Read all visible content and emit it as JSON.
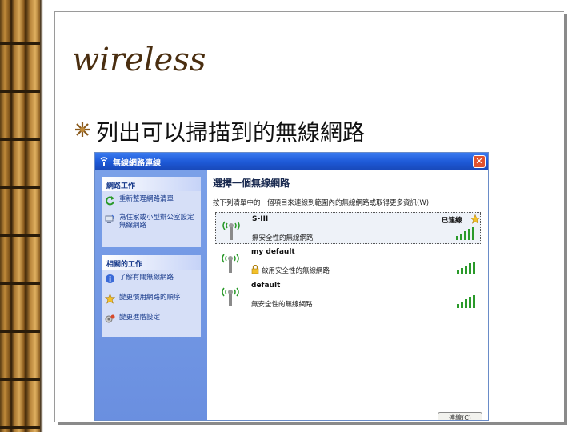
{
  "slide": {
    "title": "wireless",
    "bullet": "列出可以掃描到的無線網路"
  },
  "window": {
    "title": "無線網路連線",
    "close_label": "✕"
  },
  "sidebar": {
    "network_tasks": {
      "header": "網路工作",
      "items": [
        {
          "icon": "refresh-icon",
          "label": "重新整理網路清單"
        },
        {
          "icon": "home-network-icon",
          "label": "為住家或小型辦公室設定無線網路"
        }
      ]
    },
    "related_tasks": {
      "header": "相關的工作",
      "items": [
        {
          "icon": "info-icon",
          "label": "了解有關無線網路"
        },
        {
          "icon": "star-icon",
          "label": "變更慣用網路的順序"
        },
        {
          "icon": "settings-icon",
          "label": "變更進階設定"
        }
      ]
    }
  },
  "main": {
    "title": "選擇一個無線網路",
    "description": "按下列清單中的一個項目來連線到範圍內的無線網路或取得更多資訊(W)",
    "networks": [
      {
        "name": "S-III",
        "status": "無安全性的無線網路",
        "connection": "已連線",
        "signal": 5,
        "selected": true
      },
      {
        "name": "my default",
        "status": "啟用安全性的無線網路",
        "connection": "",
        "signal": 5,
        "selected": false
      },
      {
        "name": "default",
        "status": "無安全性的無線網路",
        "connection": "",
        "signal": 5,
        "selected": false
      }
    ],
    "button_label": "連線(C)"
  },
  "colors": {
    "titlebar": "#1e5ad8",
    "sidebar": "#6a8fe0",
    "signal": "#2a9a2a",
    "title_text": "#4a2e10"
  }
}
